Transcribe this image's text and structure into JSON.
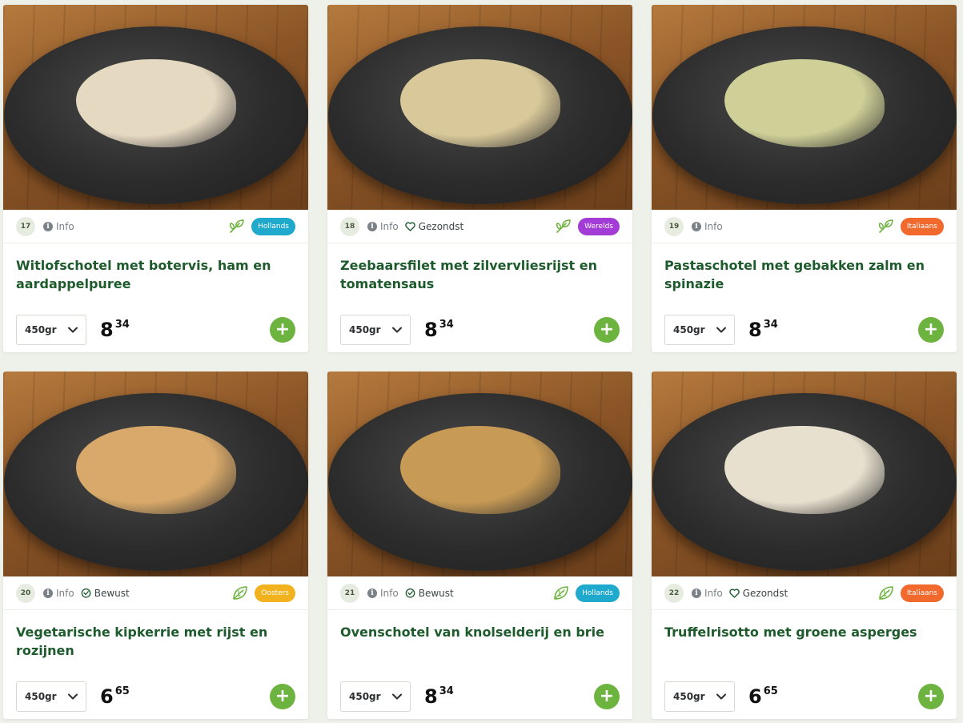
{
  "colors": {
    "accent_green": "#6db33f",
    "title_green": "#1e5b2c",
    "badge_hollands": "#1fa9cc",
    "badge_wereld": "#a33bd6",
    "badge_italiaans": "#f2692e",
    "badge_oosters": "#f1b21d"
  },
  "products": [
    {
      "number": "17",
      "info_label": "Info",
      "tag": null,
      "leaf_icon": "sprout-icon",
      "badge": {
        "label": "Hollands",
        "color": "#1fa9cc"
      },
      "title": "Witlofschotel met botervis, ham en aardappelpuree",
      "weight": "450gr",
      "price_euros": "8",
      "price_cents": "34",
      "add_label": "+",
      "food_color": "#e6d9c2"
    },
    {
      "number": "18",
      "info_label": "Info",
      "tag": {
        "label": "Gezondst",
        "icon": "heart-icon"
      },
      "leaf_icon": "sprout-icon",
      "badge": {
        "label": "Werelds",
        "color": "#a33bd6"
      },
      "title": "Zeebaarsfilet met zilvervliesrijst en tomatensaus",
      "weight": "450gr",
      "price_euros": "8",
      "price_cents": "34",
      "add_label": "+",
      "food_color": "#d9c99a"
    },
    {
      "number": "19",
      "info_label": "Info",
      "tag": null,
      "leaf_icon": "sprout-icon",
      "badge": {
        "label": "Italiaans",
        "color": "#f2692e"
      },
      "title": "Pastaschotel met gebakken zalm en spinazie",
      "weight": "450gr",
      "price_euros": "8",
      "price_cents": "34",
      "add_label": "+",
      "food_color": "#cfcf98"
    },
    {
      "number": "20",
      "info_label": "Info",
      "tag": {
        "label": "Bewust",
        "icon": "smile-badge-icon"
      },
      "leaf_icon": "leaf-icon",
      "badge": {
        "label": "Oosters",
        "color": "#f1b21d"
      },
      "title": "Vegetarische kipkerrie met rijst en rozijnen",
      "weight": "450gr",
      "price_euros": "6",
      "price_cents": "65",
      "add_label": "+",
      "food_color": "#d8a96a"
    },
    {
      "number": "21",
      "info_label": "Info",
      "tag": {
        "label": "Bewust",
        "icon": "smile-badge-icon"
      },
      "leaf_icon": "leaf-icon",
      "badge": {
        "label": "Hollands",
        "color": "#1fa9cc"
      },
      "title": "Ovenschotel van knolselderij en brie",
      "weight": "450gr",
      "price_euros": "8",
      "price_cents": "34",
      "add_label": "+",
      "food_color": "#c79a55"
    },
    {
      "number": "22",
      "info_label": "Info",
      "tag": {
        "label": "Gezondst",
        "icon": "heart-icon"
      },
      "leaf_icon": "leaf-icon",
      "badge": {
        "label": "Italiaans",
        "color": "#f2692e"
      },
      "title": "Truffelrisotto met groene asperges",
      "weight": "450gr",
      "price_euros": "6",
      "price_cents": "65",
      "add_label": "+",
      "food_color": "#e8e0cf"
    }
  ]
}
